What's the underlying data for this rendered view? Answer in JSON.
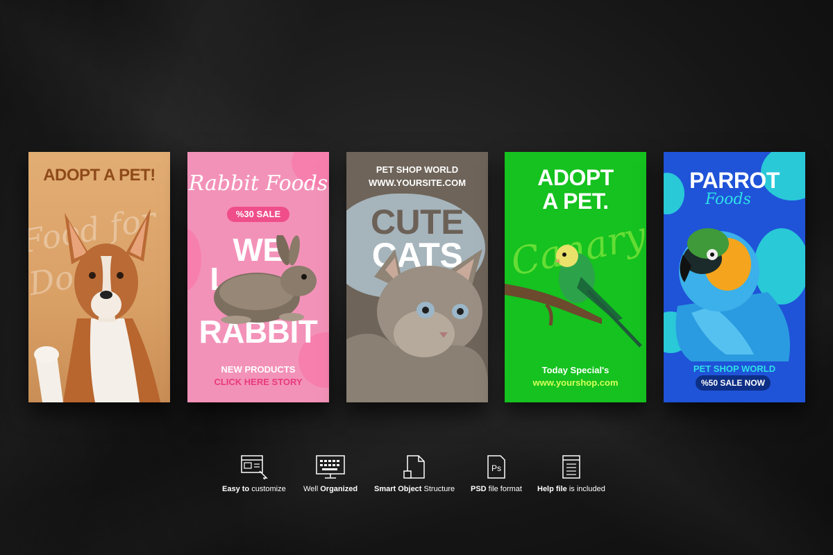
{
  "cards": [
    {
      "title": "ADOPT A PET!",
      "script_bg": "Food for Dogs",
      "colors": {
        "bg": "#dba36a",
        "title": "#8e4a1a"
      }
    },
    {
      "script_title": "Rabbit Foods",
      "sale": "%30 SALE",
      "line1": "WE",
      "line2": "L",
      "line3": "RABBIT",
      "products": "NEW PRODUCTS",
      "cta": "CLICK HERE STORY",
      "colors": {
        "bg": "#f392b8",
        "accent": "#ef4e8a"
      }
    },
    {
      "shop": "PET SHOP WORLD",
      "site": "WWW.YOURSITE.COM",
      "line1": "CUTE",
      "line2": "CATS",
      "colors": {
        "bg": "#6e6459",
        "blob": "#a6b4bc"
      }
    },
    {
      "line1": "ADOPT",
      "line2": "A PET.",
      "script_bg": "Canary",
      "special": "Today Special's",
      "url": "www.yourshop.com",
      "colors": {
        "bg": "#15c21f",
        "accent": "#d4ff5a"
      }
    },
    {
      "title": "PARROT",
      "script": "Foods",
      "shop": "PET SHOP WORLD",
      "sale": "%50 SALE NOW",
      "colors": {
        "bg": "#1f53d8",
        "accent": "#29c9d8"
      }
    }
  ],
  "features": [
    {
      "icon": "customize-icon",
      "bold": "Easy to",
      "rest": " customize"
    },
    {
      "icon": "monitor-keyboard-icon",
      "plain": "Well ",
      "bold": "Organized"
    },
    {
      "icon": "smart-object-icon",
      "bold": "Smart Object",
      "rest": " Structure"
    },
    {
      "icon": "psd-file-icon",
      "bold": "PSD",
      "rest": " file format",
      "icon_text": "Ps"
    },
    {
      "icon": "help-file-icon",
      "bold": "Help file",
      "rest": " is included"
    }
  ]
}
